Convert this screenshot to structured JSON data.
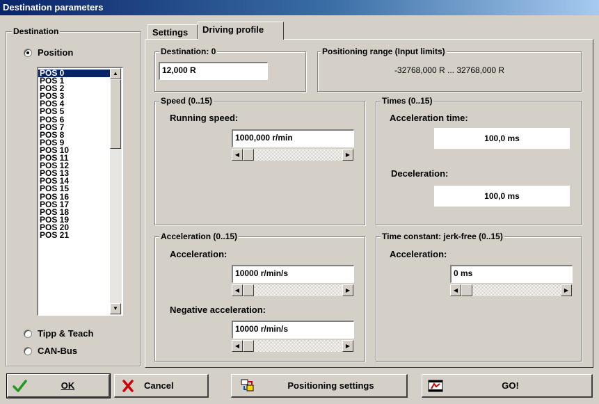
{
  "window": {
    "title": "Destination parameters"
  },
  "destination_group": {
    "legend": "Destination",
    "radio_position": "Position",
    "radio_tipp_teach": "Tipp & Teach",
    "radio_can_bus": "CAN-Bus",
    "selected": "Position",
    "positions": [
      "POS 0",
      "POS 1",
      "POS 2",
      "POS 3",
      "POS 4",
      "POS 5",
      "POS 6",
      "POS 7",
      "POS 8",
      "POS 9",
      "POS 10",
      "POS 11",
      "POS 12",
      "POS 13",
      "POS 14",
      "POS 15",
      "POS 16",
      "POS 17",
      "POS 18",
      "POS 19",
      "POS 20",
      "POS 21"
    ],
    "selected_position": "POS 0"
  },
  "tabs": [
    {
      "label": "Settings",
      "active": false
    },
    {
      "label": "Driving profile",
      "active": true
    }
  ],
  "destination": {
    "legend": "Destination: 0",
    "value": "12,000 R"
  },
  "positioning_range": {
    "legend": "Positioning range (Input limits)",
    "text": "-32768,000  R ...  32768,000  R"
  },
  "speed": {
    "legend": "Speed (0..15)",
    "label": "Running speed:",
    "value": "1000,000  r/min"
  },
  "times": {
    "legend": "Times (0..15)",
    "accel_label": "Acceleration time:",
    "accel_value": "100,0 ms",
    "decel_label": "Deceleration:",
    "decel_value": "100,0 ms"
  },
  "acceleration": {
    "legend": "Acceleration (0..15)",
    "accel_label": "Acceleration:",
    "accel_value": "10000  r/min/s",
    "neg_label": "Negative acceleration:",
    "neg_value": "10000  r/min/s"
  },
  "jerk_free": {
    "legend": "Time constant: jerk-free (0..15)",
    "accel_label": "Acceleration:",
    "accel_value": "0 ms"
  },
  "buttons": {
    "ok": "OK",
    "cancel": "Cancel",
    "positioning_settings": "Positioning settings",
    "go": "GO!"
  },
  "colors": {
    "selection": "#0a246a",
    "ok_check": "#1f9a1f",
    "cancel_x": "#cc0000",
    "dialog_bg": "#d4d0c8"
  },
  "icons": [
    "check-icon",
    "cancel-x-icon",
    "positioning-settings-icon",
    "go-icon"
  ]
}
